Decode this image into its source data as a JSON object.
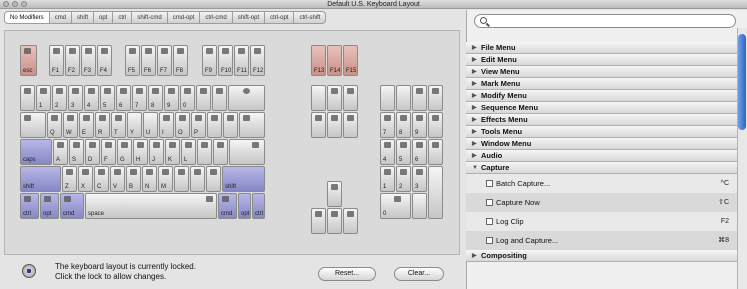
{
  "window": {
    "title": "Default U.S. Keyboard Layout"
  },
  "tabs": [
    "No Modifiers",
    "cmd",
    "shift",
    "opt",
    "ctrl",
    "shift-cmd",
    "cmd-opt",
    "ctrl-cmd",
    "shift-opt",
    "ctrl-opt",
    "ctrl-shift"
  ],
  "keys": {
    "esc": "esc",
    "f1": "F1",
    "f2": "F2",
    "f3": "F3",
    "f4": "F4",
    "f5": "F5",
    "f6": "F6",
    "f7": "F7",
    "f8": "F8",
    "f9": "F9",
    "f10": "F10",
    "f11": "F11",
    "f12": "F12",
    "f13": "F13",
    "f14": "F14",
    "f15": "F15",
    "n1": "1",
    "n2": "2",
    "n3": "3",
    "n4": "4",
    "n5": "5",
    "n6": "6",
    "n7": "7",
    "n8": "8",
    "n9": "9",
    "n0": "0",
    "q": "Q",
    "w": "W",
    "e": "E",
    "r": "R",
    "t": "T",
    "y": "Y",
    "u": "U",
    "i": "I",
    "o": "O",
    "p": "P",
    "caps": "caps",
    "a": "A",
    "s": "S",
    "d": "D",
    "f": "F",
    "g": "G",
    "h": "H",
    "j": "J",
    "k": "K",
    "l": "L",
    "shift_l": "shift",
    "z": "Z",
    "x": "X",
    "c": "C",
    "v": "V",
    "b": "B",
    "n": "N",
    "m": "M",
    "shift_r": "shift",
    "ctrl_l": "ctrl",
    "opt_l": "opt",
    "cmd_l": "cmd",
    "space": "space",
    "cmd_r": "cmd",
    "opt_r": "opt",
    "ctrl_r": "ctrl",
    "np7": "7",
    "np8": "8",
    "np9": "9",
    "np4": "4",
    "np5": "5",
    "np6": "6",
    "np1": "1",
    "np2": "2",
    "np3": "3",
    "np0": "0"
  },
  "status": {
    "line1": "The keyboard layout is currently locked.",
    "line2": "Click the lock to allow changes."
  },
  "buttons": {
    "reset": "Reset...",
    "clear": "Clear..."
  },
  "search": {
    "placeholder": ""
  },
  "menus": [
    {
      "label": "File Menu",
      "expanded": false
    },
    {
      "label": "Edit Menu",
      "expanded": false
    },
    {
      "label": "View Menu",
      "expanded": false
    },
    {
      "label": "Mark Menu",
      "expanded": false
    },
    {
      "label": "Modify Menu",
      "expanded": false
    },
    {
      "label": "Sequence Menu",
      "expanded": false
    },
    {
      "label": "Effects Menu",
      "expanded": false
    },
    {
      "label": "Tools Menu",
      "expanded": false
    },
    {
      "label": "Window Menu",
      "expanded": false
    },
    {
      "label": "Audio",
      "expanded": false
    },
    {
      "label": "Capture",
      "expanded": true
    }
  ],
  "capture_items": [
    {
      "label": "Batch Capture...",
      "shortcut": "^C"
    },
    {
      "label": "Capture Now",
      "shortcut": "⇧C"
    },
    {
      "label": "Log Clip",
      "shortcut": "F2"
    },
    {
      "label": "Log and Capture...",
      "shortcut": "⌘8"
    }
  ],
  "last_menu": {
    "label": "Compositing"
  },
  "colors": {
    "fkey_red": "#c99189",
    "modifier_blue": "#8787c5",
    "scroll_blue": "#2c64c8"
  }
}
